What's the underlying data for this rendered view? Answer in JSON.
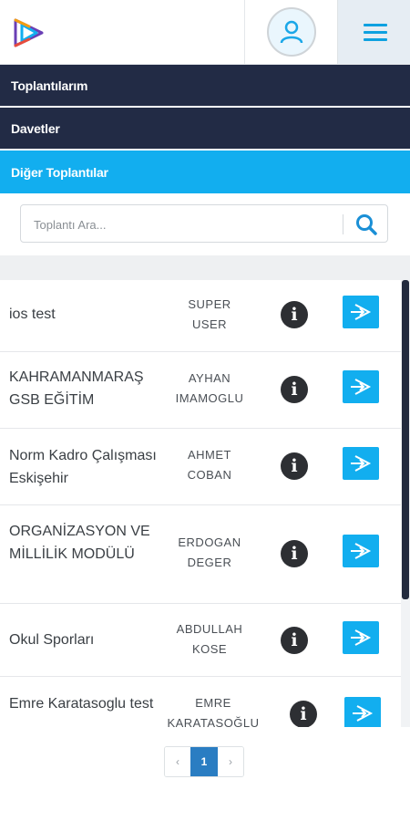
{
  "header": {
    "logo_icon": "play-logo-icon",
    "avatar_icon": "user-icon",
    "menu_icon": "hamburger-icon"
  },
  "nav": {
    "items": [
      {
        "label": "Toplantılarım",
        "active": false
      },
      {
        "label": "Davetler",
        "active": false
      },
      {
        "label": "Diğer Toplantılar",
        "active": true
      }
    ]
  },
  "search": {
    "placeholder": "Toplantı Ara...",
    "value": "",
    "icon": "search-icon"
  },
  "meetings": [
    {
      "title": "ios test",
      "user_line1": "SUPER",
      "user_line2": "USER"
    },
    {
      "title": "KAHRAMANMARAŞ GSB EĞİTİM",
      "user_line1": "AYHAN",
      "user_line2": "IMAMOGLU"
    },
    {
      "title": "Norm Kadro Çalışması Eskişehir",
      "user_line1": "AHMET",
      "user_line2": "COBAN"
    },
    {
      "title": "ORGANİZASYON VE MİLLİLİK MODÜLÜ",
      "user_line1": "ERDOGAN",
      "user_line2": "DEGER"
    },
    {
      "title": "Okul Sporları",
      "user_line1": "ABDULLAH",
      "user_line2": "KOSE"
    },
    {
      "title": "Emre Karatasoglu test",
      "user_line1": "EMRE",
      "user_line2": "KARATAŞOĞLU"
    }
  ],
  "row_icons": {
    "info": "info-icon",
    "join": "join-meeting-icon",
    "info_glyph": "i"
  },
  "pagination": {
    "prev": "‹",
    "current": "1",
    "next": "›"
  },
  "colors": {
    "nav_bg": "#222b45",
    "accent": "#12aeef",
    "page_active": "#2a7dc2"
  }
}
